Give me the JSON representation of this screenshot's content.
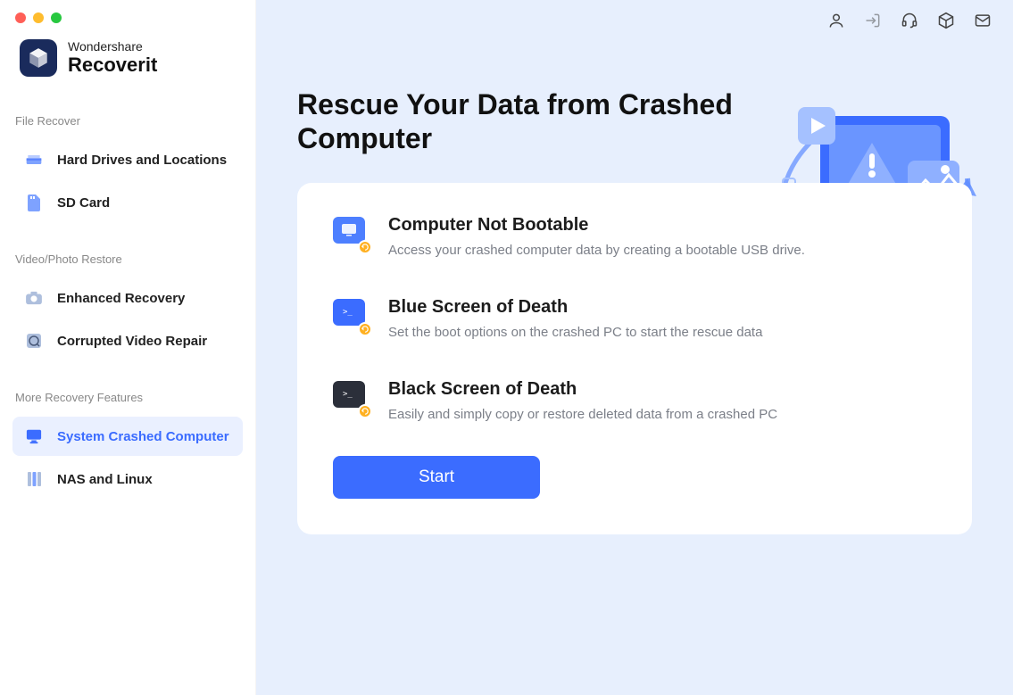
{
  "brand": {
    "top": "Wondershare",
    "bottom": "Recoverit"
  },
  "sidebar": {
    "sections": [
      {
        "label": "File Recover",
        "items": [
          {
            "label": "Hard Drives and Locations",
            "icon": "hdd",
            "active": false
          },
          {
            "label": "SD Card",
            "icon": "sd",
            "active": false
          }
        ]
      },
      {
        "label": "Video/Photo Restore",
        "items": [
          {
            "label": "Enhanced Recovery",
            "icon": "camera",
            "active": false
          },
          {
            "label": "Corrupted Video Repair",
            "icon": "repair",
            "active": false
          }
        ]
      },
      {
        "label": "More Recovery Features",
        "items": [
          {
            "label": "System Crashed Computer",
            "icon": "monitor",
            "active": true
          },
          {
            "label": "NAS and Linux",
            "icon": "nas",
            "active": false
          }
        ]
      }
    ]
  },
  "topbar": {
    "icons": [
      "user",
      "login",
      "headset",
      "cube",
      "mail"
    ]
  },
  "main": {
    "title": "Rescue Your Data from Crashed Computer",
    "features": [
      {
        "title": "Computer Not Bootable",
        "desc": "Access your crashed computer data by creating a bootable USB drive.",
        "icon_bg": "#4d7fff",
        "icon_kind": "monitor"
      },
      {
        "title": "Blue Screen of Death",
        "desc": "Set the boot options on the crashed PC to start the rescue data",
        "icon_bg": "#3b6cff",
        "icon_kind": "terminal"
      },
      {
        "title": "Black Screen of Death",
        "desc": "Easily and simply copy or restore deleted data from a crashed PC",
        "icon_bg": "#2b2f3a",
        "icon_kind": "terminal"
      }
    ],
    "start_label": "Start"
  },
  "colors": {
    "accent": "#3b6cff",
    "panel_bg": "#e7effd"
  }
}
